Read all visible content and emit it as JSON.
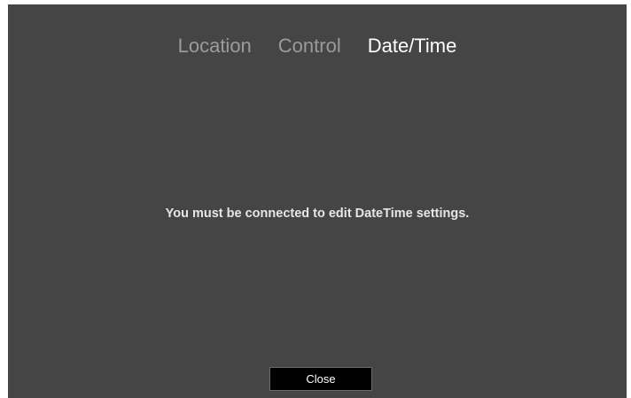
{
  "tabs": [
    {
      "label": "Location",
      "active": false
    },
    {
      "label": "Control",
      "active": false
    },
    {
      "label": "Date/Time",
      "active": true
    }
  ],
  "message": "You must be connected to edit DateTime settings.",
  "close_label": "Close",
  "colors": {
    "panel_bg": "#454545",
    "tab_inactive": "#9b9b9b",
    "tab_active": "#ffffff",
    "button_bg": "#000000"
  }
}
